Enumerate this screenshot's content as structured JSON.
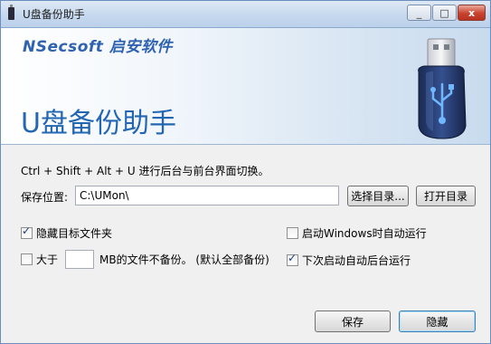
{
  "window": {
    "title": "U盘备份助手",
    "min_label": "_",
    "max_label": "□",
    "close_label": "x"
  },
  "banner": {
    "brand": "NSecsoft 启安软件",
    "title": "U盘备份助手"
  },
  "main": {
    "info_text": "Ctrl + Shift + Alt + U 进行后台与前台界面切换。",
    "path_label": "保存位置:",
    "path_value": "C:\\UMon\\",
    "browse_button": "选择目录...",
    "open_button": "打开目录",
    "options": {
      "hide_folder": {
        "label": "隐藏目标文件夹",
        "checked": true
      },
      "start_with_windows": {
        "label": "启动Windows时自动运行",
        "checked": false
      },
      "size_limit_prefix": "大于",
      "size_limit_value": "",
      "size_limit_suffix": "MB的文件不备份。 (默认全部备份)",
      "size_limit_checked": false,
      "next_start_background": {
        "label": "下次启动自动后台运行",
        "checked": true
      }
    },
    "save_button": "保存",
    "hide_button": "隐藏"
  },
  "colors": {
    "brand_blue": "#2f62b0",
    "title_blue": "#2367b3"
  }
}
